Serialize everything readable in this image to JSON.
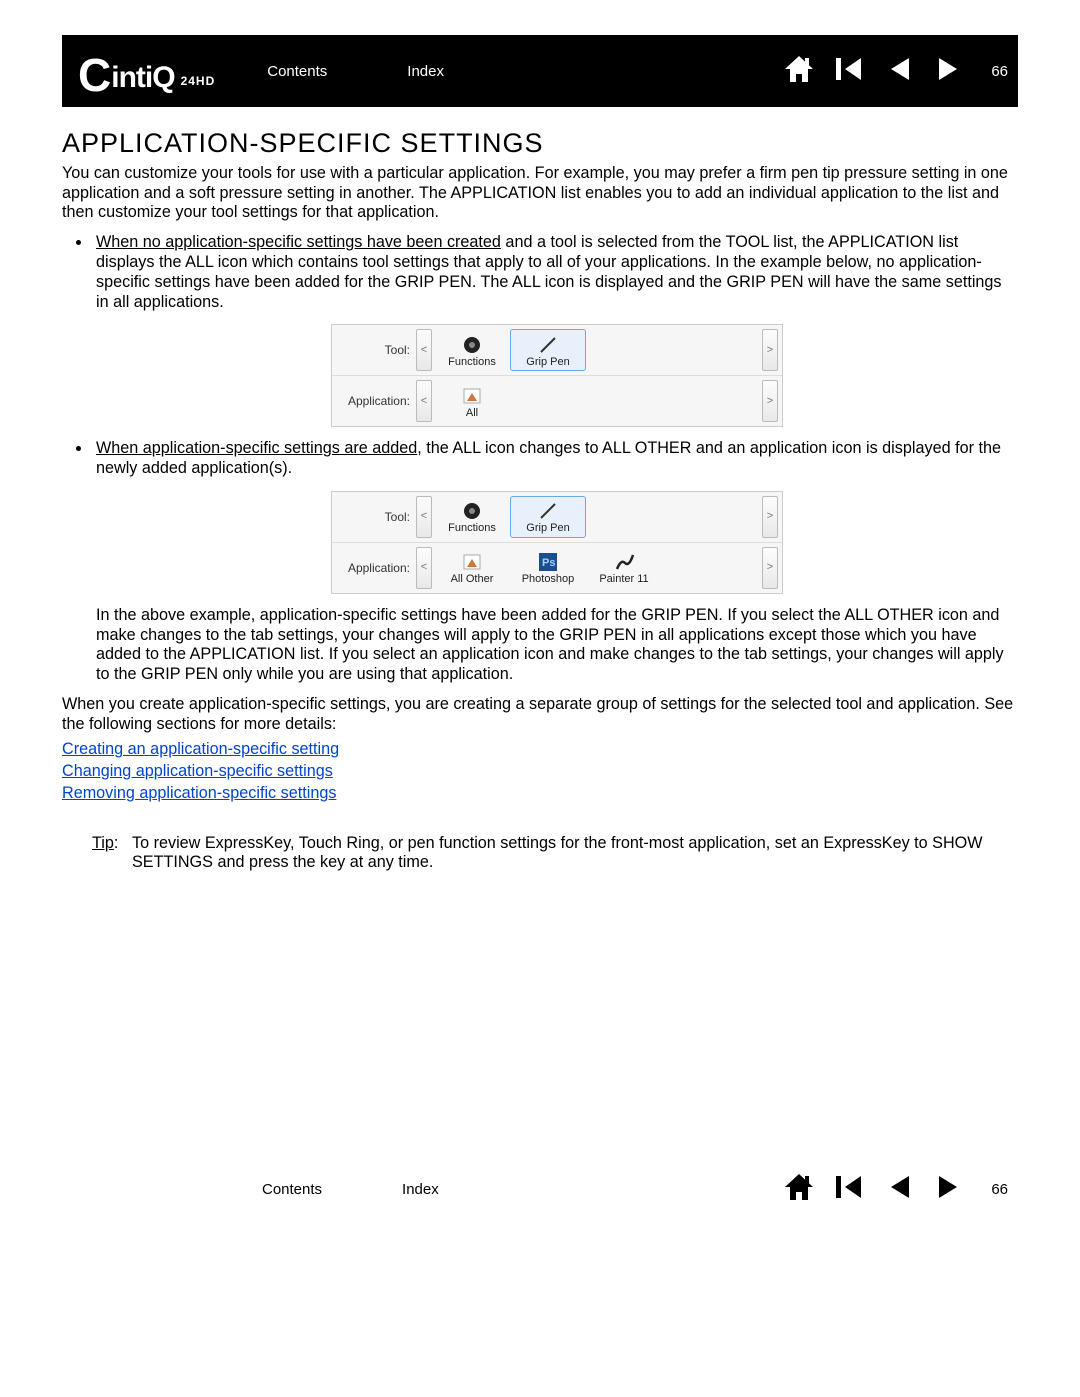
{
  "header": {
    "logo_main": "intiQ",
    "logo_c": "C",
    "logo_sub": "24HD",
    "contents": "Contents",
    "index": "Index",
    "page": "66"
  },
  "title": "APPLICATION-SPECIFIC SETTINGS",
  "intro": "You can customize your tools for use with a particular application.  For example, you may prefer a firm pen tip pressure setting in one application and a soft pressure setting in another.  The APPLICATION list enables you to add an individual application to the list and then customize your tool settings for that application.",
  "bullet1_u": "When no application-specific settings have been created",
  "bullet1_rest": " and a tool is selected from the TOOL list, the APPLICATION list displays the ALL icon which contains tool settings that apply to all of your applications.  In the example below, no application-specific settings have been added for the GRIP PEN.  The ALL icon is displayed and the GRIP PEN will have the same settings in all applications.",
  "panel1": {
    "tool_label": "Tool:",
    "app_label": "Application:",
    "tools": [
      "Functions",
      "Grip Pen"
    ],
    "apps": [
      "All"
    ]
  },
  "bullet2_u": "When application-specific settings are added",
  "bullet2_rest": ", the ALL icon changes to ALL OTHER and an application icon is displayed for the newly added application(s).",
  "panel2": {
    "tool_label": "Tool:",
    "app_label": "Application:",
    "tools": [
      "Functions",
      "Grip Pen"
    ],
    "apps": [
      "All Other",
      "Photoshop",
      "Painter 11"
    ]
  },
  "after_panel2": "In the above example, application-specific settings have been added for the GRIP PEN.  If you select the ALL OTHER icon and make changes to the tab settings, your changes will apply to the GRIP PEN in all applications except those which you have added to the APPLICATION list.  If you select an application icon and make changes to the tab settings, your changes will apply to the GRIP PEN only while you are using that application.",
  "para2": "When you create application-specific settings, you are creating a separate group of settings for the selected tool and application.  See the following sections for more details:",
  "links": [
    "Creating an application-specific setting",
    "Changing application-specific settings",
    "Removing application-specific settings"
  ],
  "tip_label": "Tip",
  "tip_text": "To review ExpressKey, Touch Ring, or pen function settings for the front-most application, set an ExpressKey to SHOW SETTINGS and press the key at any time.",
  "footer": {
    "contents": "Contents",
    "index": "Index",
    "page": "66"
  }
}
